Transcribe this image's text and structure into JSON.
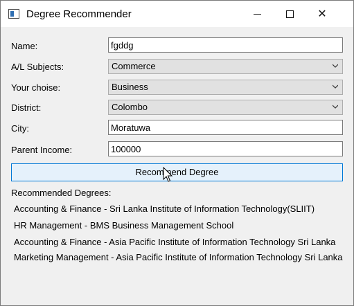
{
  "window": {
    "title": "Degree Recommender",
    "controls": {
      "minimize": "minimize",
      "maximize": "maximize",
      "close": "✕"
    }
  },
  "form": {
    "name_label": "Name:",
    "name_value": "fgddg",
    "subjects_label": "A/L Subjects:",
    "subjects_value": "Commerce",
    "choice_label": "Your choise:",
    "choice_value": "Business",
    "district_label": "District:",
    "district_value": "Colombo",
    "city_label": "City:",
    "city_value": "Moratuwa",
    "income_label": "Parent Income:",
    "income_value": "100000"
  },
  "action": {
    "recommend_label": "Recommend Degree"
  },
  "results": {
    "heading": "Recommended Degrees:",
    "items": [
      "Accounting & Finance - Sri Lanka Institute of Information Technology(SLIIT)",
      "HR Management - BMS Business Management School",
      "Accounting & Finance - Asia Pacific Institute of Information Technology Sri Lanka",
      "Marketing Management - Asia Pacific Institute of Information Technology Sri Lanka"
    ]
  },
  "colors": {
    "accent": "#0078d7",
    "button_bg": "#e5f1fb",
    "window_bg": "#f0f0f0"
  }
}
